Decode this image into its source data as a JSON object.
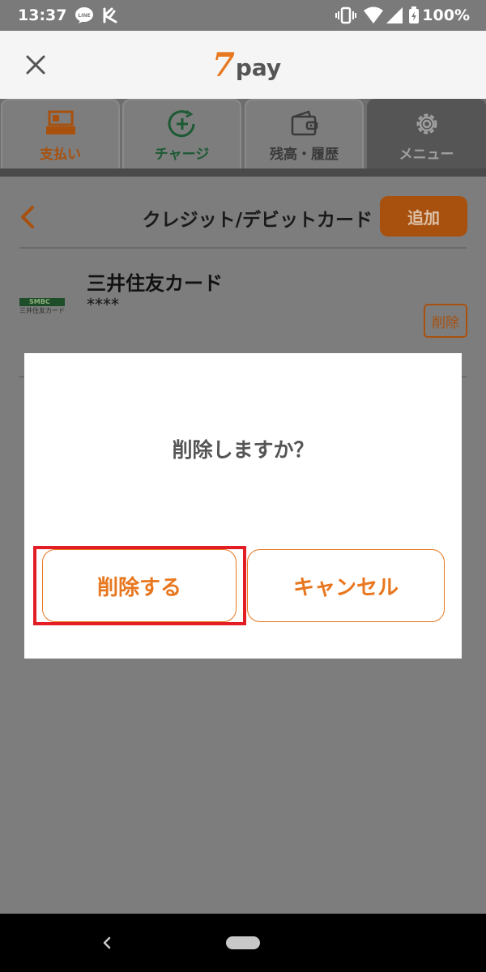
{
  "status_bar": {
    "time": "13:37",
    "battery": "100%",
    "icons": [
      "line-icon",
      "notification-check-icon",
      "vibrate-icon",
      "wifi-icon",
      "signal-icon",
      "battery-charging-icon"
    ]
  },
  "header": {
    "logo_seven": "7",
    "logo_pay": "pay",
    "close_icon": "close-icon"
  },
  "tabs": [
    {
      "label": "支払い",
      "icon": "register-icon",
      "color": "#a8510f",
      "active": false
    },
    {
      "label": "チャージ",
      "icon": "charge-plus-icon",
      "color": "#1d5a34",
      "active": false
    },
    {
      "label": "残高・履歴",
      "icon": "wallet-icon",
      "color": "#3a3a3a",
      "active": false
    },
    {
      "label": "メニュー",
      "icon": "gear-icon",
      "color": "#a0a0a0",
      "active": true
    }
  ],
  "page": {
    "title": "クレジット/デビットカード",
    "add_label": "追加"
  },
  "card": {
    "logo_top": "SMBC",
    "logo_bottom": "三井住友カード",
    "name": "三井住友カード",
    "number": "****",
    "delete_label": "削除"
  },
  "dialog": {
    "message": "削除しますか？",
    "confirm_label": "削除する",
    "cancel_label": "キャンセル"
  },
  "colors": {
    "accent": "#e8771f",
    "highlight": "#e21d24",
    "overlay": "#7d7d7d"
  }
}
